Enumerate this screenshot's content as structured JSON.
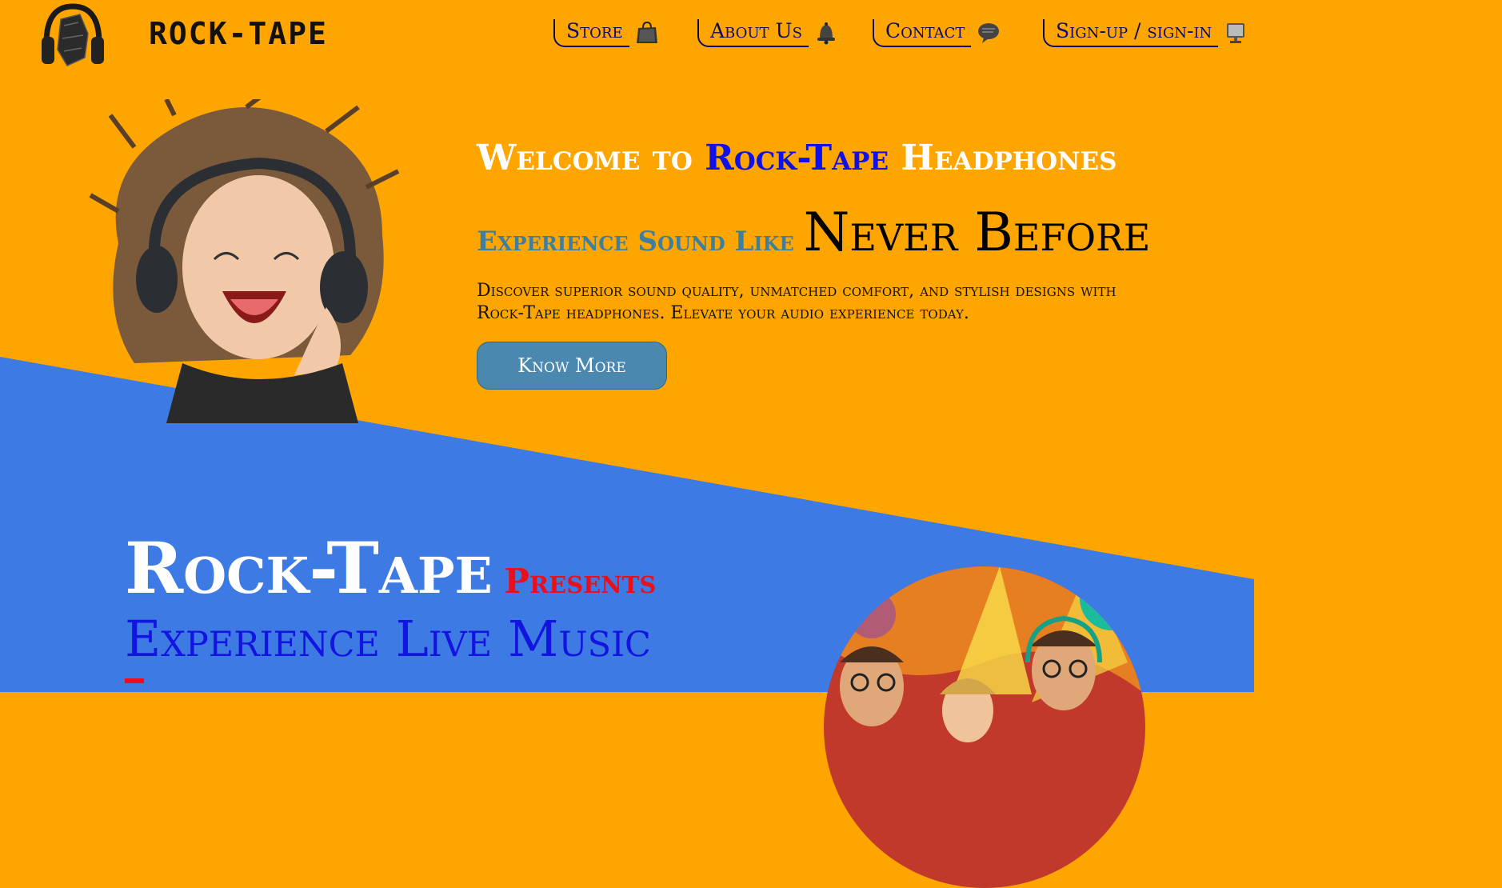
{
  "colors": {
    "hero_bg": "#ffa500",
    "section_bg": "#3d7ae4",
    "accent_blue": "#1010e8",
    "accent_red": "#e8101a"
  },
  "header": {
    "brand": "ROCK-TAPE",
    "logo_icon": "headphones-logo-icon",
    "nav": [
      {
        "label": "Store",
        "icon": "shopping-bag-icon"
      },
      {
        "label": "About Us",
        "icon": "bell-icon"
      },
      {
        "label": "Contact",
        "icon": "speech-bubble-icon"
      },
      {
        "label": "Sign-up / sign-in",
        "icon": "monitor-icon"
      }
    ]
  },
  "hero": {
    "title_pre": "Welcome to ",
    "title_highlight": "Rock-Tape",
    "title_post": " Headphones",
    "sub_a": "Experience Sound Like ",
    "sub_b": "Never Before",
    "description": "Discover superior sound quality, unmatched comfort, and stylish designs with Rock-Tape headphones. Elevate your audio experience today.",
    "button": "Know More",
    "image": "girl-with-headphones-image"
  },
  "section2": {
    "title_a": "Rock-Tape",
    "title_b": " Presents",
    "subtitle": "Experience Live Music",
    "image": "concert-crowd-image"
  }
}
